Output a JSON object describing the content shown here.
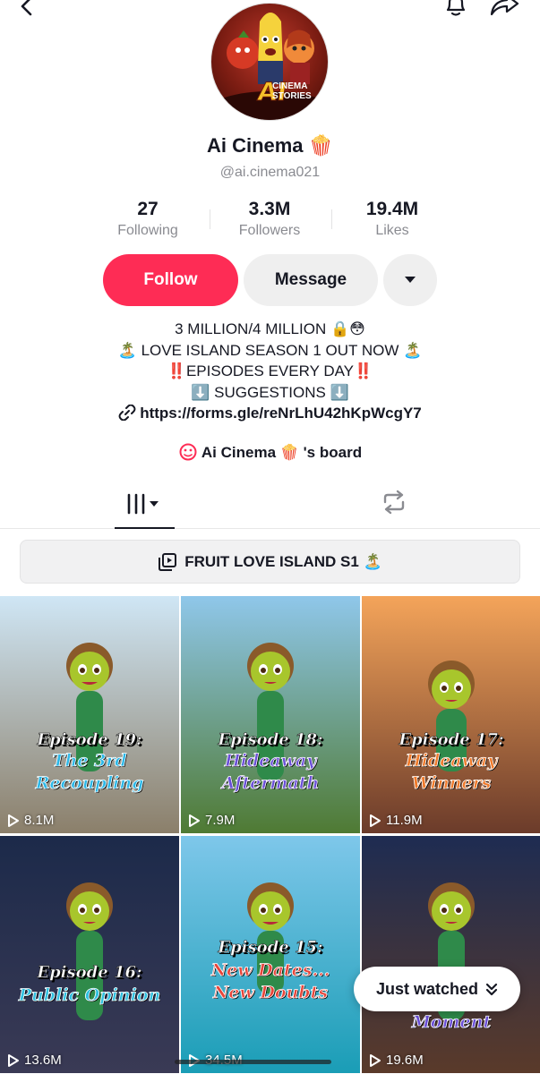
{
  "profile": {
    "name": "Ai Cinema 🍿",
    "handle": "@ai.cinema021",
    "avatar_logo_big": "AI",
    "avatar_logo_line1": "CINEMA",
    "avatar_logo_line2": "STORIES"
  },
  "stats": [
    {
      "value": "27",
      "label": "Following"
    },
    {
      "value": "3.3M",
      "label": "Followers"
    },
    {
      "value": "19.4M",
      "label": "Likes"
    }
  ],
  "actions": {
    "follow_label": "Follow",
    "message_label": "Message"
  },
  "bio": {
    "line1": "3 MILLION/4 MILLION 🔒😳",
    "line2": "🏝️ LOVE ISLAND SEASON 1 OUT NOW 🏝️",
    "line3": "‼️EPISODES EVERY DAY‼️",
    "line4": "⬇️ SUGGESTIONS ⬇️",
    "link": "https://forms.gle/reNrLhU42hKpWcgY7"
  },
  "board": {
    "label": "Ai Cinema 🍿 's board"
  },
  "playlist": {
    "label": "FRUIT LOVE ISLAND S1 🏝️"
  },
  "videos": [
    {
      "episode": "Episode 19:",
      "sub1": "The 3rd",
      "sub2": "Recoupling",
      "views": "8.1M",
      "sub_color": "#2bb8e8",
      "bg_top": "#cfe6f5",
      "bg_bottom": "#8b7f6a"
    },
    {
      "episode": "Episode 18:",
      "sub1": "Hideaway",
      "sub2": "Aftermath",
      "views": "7.9M",
      "sub_color": "#6b4fd8",
      "bg_top": "#8fc7ea",
      "bg_bottom": "#4f7a33"
    },
    {
      "episode": "Episode 17:",
      "sub1": "Hideaway",
      "sub2": "Winners",
      "views": "11.9M",
      "sub_color": "#f07a2a",
      "bg_top": "#f4a45a",
      "bg_bottom": "#6b3b2a"
    },
    {
      "episode": "Episode 16:",
      "sub1": "Public Opinion",
      "sub2": "",
      "views": "13.6M",
      "sub_color": "#2fc0e0",
      "bg_top": "#1c2a4a",
      "bg_bottom": "#3a3a55"
    },
    {
      "episode": "Episode 15:",
      "sub1": "New Dates...",
      "sub2": "New Doubts",
      "views": "34.5M",
      "sub_color": "#e8453a",
      "bg_top": "#7ec7ea",
      "bg_bottom": "#1a9db6"
    },
    {
      "episode": "",
      "sub1": "",
      "sub2": "Moment",
      "views": "19.6M",
      "sub_color": "#6b4fd8",
      "bg_top": "#1e2c52",
      "bg_bottom": "#5a3a2a"
    }
  ],
  "just_watched": {
    "label": "Just watched"
  }
}
